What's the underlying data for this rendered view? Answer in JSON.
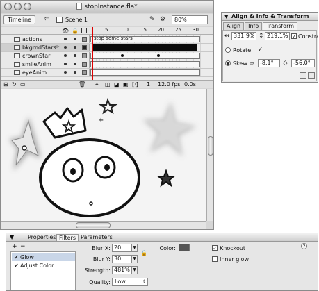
{
  "main_window": {
    "title": "stopInstance.fla*",
    "toolbar": {
      "timeline_button": "Timeline",
      "scene_label": "Scene 1",
      "zoom": "80%"
    },
    "timeline": {
      "frame_numbers": [
        "1",
        "5",
        "10",
        "15",
        "20",
        "25",
        "30"
      ],
      "layers": [
        {
          "name": "actions",
          "frame_label": "stop some stars"
        },
        {
          "name": "bkgrndStars",
          "frame_label": ""
        },
        {
          "name": "crownStar",
          "frame_label": ""
        },
        {
          "name": "smileAnim",
          "frame_label": ""
        },
        {
          "name": "eyeAnim",
          "frame_label": ""
        }
      ],
      "footer": {
        "current_frame": "1",
        "fps": "12.0 fps",
        "elapsed": "0.0s"
      }
    }
  },
  "align_panel": {
    "title": "Align & Info & Transform",
    "tabs": [
      "Align",
      "Info",
      "Transform"
    ],
    "active_tab": "Transform",
    "width_scale": "331.9%",
    "height_scale": "219.1%",
    "constrain_label": "Constrain",
    "rotate_label": "Rotate",
    "skew_label": "Skew",
    "skew_horizontal": "-8.1°",
    "skew_vertical": "-56.0°",
    "selected_mode": "Skew"
  },
  "properties_panel": {
    "tabs": [
      "Properties",
      "Filters",
      "Parameters"
    ],
    "active_tab": "Filters",
    "filters": [
      {
        "name": "Glow",
        "enabled": true,
        "selected": true
      },
      {
        "name": "Adjust Color",
        "enabled": true,
        "selected": false
      }
    ],
    "blur_x_label": "Blur X:",
    "blur_x": "20",
    "blur_y_label": "Blur Y:",
    "blur_y": "30",
    "strength_label": "Strength:",
    "strength": "481%",
    "quality_label": "Quality:",
    "quality": "Low",
    "color_label": "Color:",
    "glow_color": "#555555",
    "knockout_label": "Knockout",
    "knockout": true,
    "inner_glow_label": "Inner glow",
    "inner_glow": false
  }
}
